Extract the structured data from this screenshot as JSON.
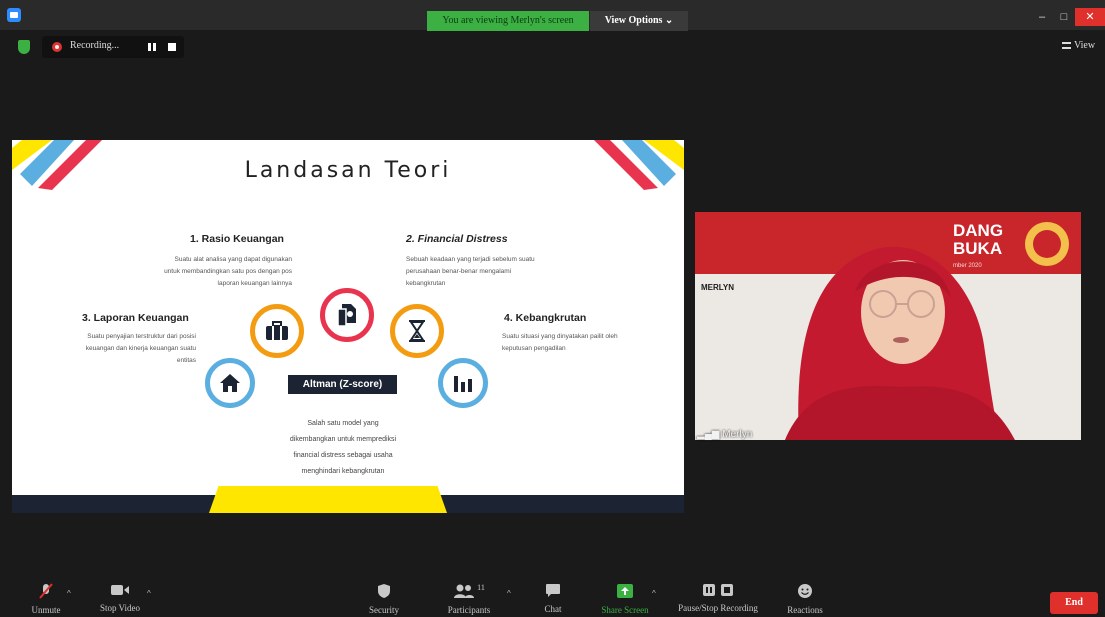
{
  "titlebar": {
    "banner": "You are viewing Merlyn's screen",
    "view_options": "View Options ⌄",
    "minimize": "–",
    "maximize": "□",
    "close": "✕"
  },
  "recording": {
    "label": "Recording..."
  },
  "view_button": "View",
  "slide": {
    "title": "Landasan Teori",
    "sections": [
      {
        "heading": "1. Rasio Keuangan",
        "lines": [
          "Suatu alat analisa yang dapat digunakan",
          "untuk membandingkan satu pos dengan pos",
          "laporan keuangan lainnya"
        ]
      },
      {
        "heading": "2. Financial Distress",
        "lines": [
          "Sebuah keadaan yang terjadi sebelum suatu",
          "perusahaan benar-benar mengalami",
          "kebangkrutan"
        ]
      },
      {
        "heading": "3. Laporan Keuangan",
        "lines": [
          "Suatu penyajian terstruktur dari posisi",
          "keuangan dan kinerja keuangan suatu",
          "entitas"
        ]
      },
      {
        "heading": "4. Kebangkrutan",
        "lines": [
          "Suatu situasi yang dinyatakan pailit oleh",
          "keputusan pengadilan"
        ]
      }
    ],
    "center_label": "Altman (Z-score)",
    "center_lines": [
      "Salah satu model yang",
      "dikembangkan untuk memprediksi",
      "financial distress sebagai usaha",
      "menghindari kebangkrutan"
    ],
    "colors": {
      "orange": "#f39c12",
      "red": "#e8344e",
      "blue": "#5aaee0",
      "yellow": "#ffe600",
      "navy": "#1c2433"
    }
  },
  "video": {
    "name_overlay": "Merlyn",
    "backdrop_text": [
      "DANG",
      "BUKA",
      "mber 2020"
    ],
    "nameplate": "MERLYN"
  },
  "toolbar": {
    "unmute": "Unmute",
    "stop_video": "Stop Video",
    "security": "Security",
    "participants": "Participants",
    "participants_count": "11",
    "chat": "Chat",
    "share_screen": "Share Screen",
    "pause_recording": "Pause/Stop Recording",
    "reactions": "Reactions",
    "end": "End"
  }
}
